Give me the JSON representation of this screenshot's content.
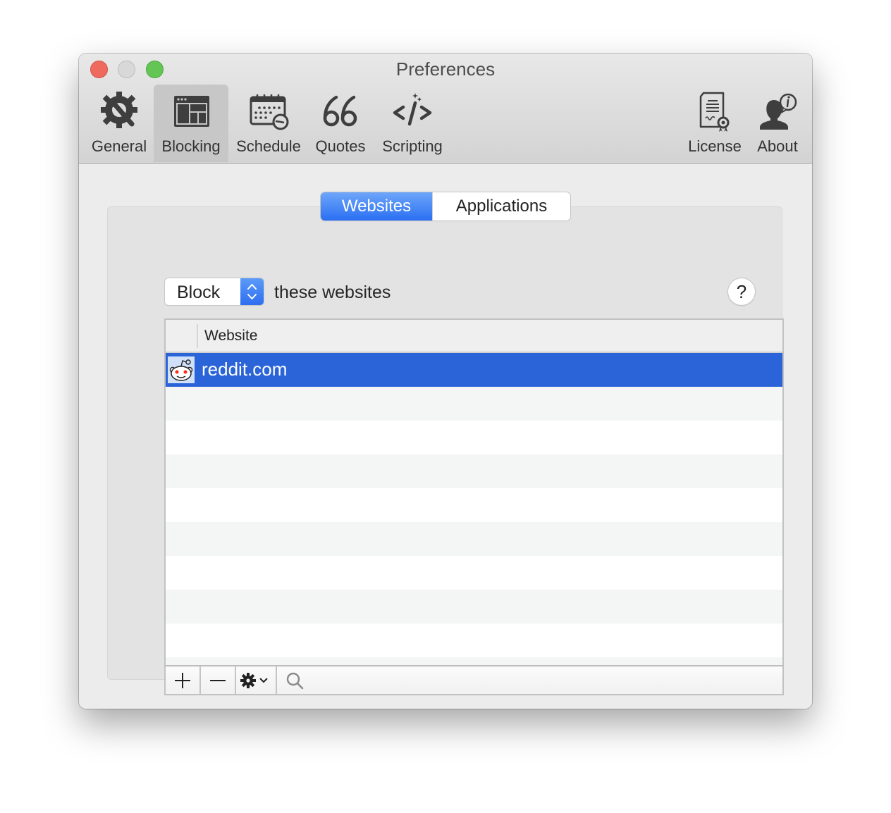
{
  "window": {
    "title": "Preferences"
  },
  "toolbar": {
    "items": [
      {
        "label": "General",
        "icon": "gear-wrench-icon",
        "selected": false
      },
      {
        "label": "Blocking",
        "icon": "window-layout-icon",
        "selected": true
      },
      {
        "label": "Schedule",
        "icon": "calendar-clock-icon",
        "selected": false
      },
      {
        "label": "Quotes",
        "icon": "quote-marks-icon",
        "selected": false
      },
      {
        "label": "Scripting",
        "icon": "code-icon",
        "selected": false
      },
      {
        "label": "License",
        "icon": "certificate-icon",
        "selected": false
      },
      {
        "label": "About",
        "icon": "person-info-icon",
        "selected": false
      }
    ]
  },
  "tabs": {
    "items": [
      {
        "label": "Websites",
        "active": true
      },
      {
        "label": "Applications",
        "active": false
      }
    ]
  },
  "mode": {
    "selected": "Block",
    "suffix": "these websites",
    "help_label": "?"
  },
  "table": {
    "columns": [
      "Website"
    ],
    "rows": [
      {
        "site": "reddit.com",
        "icon": "reddit-icon",
        "selected": true
      }
    ]
  },
  "footer": {
    "buttons": [
      "add-icon",
      "remove-icon",
      "gear-menu-icon",
      "search-icon"
    ]
  },
  "colors": {
    "accent": "#2a6ff2",
    "selection": "#2a64d8"
  }
}
